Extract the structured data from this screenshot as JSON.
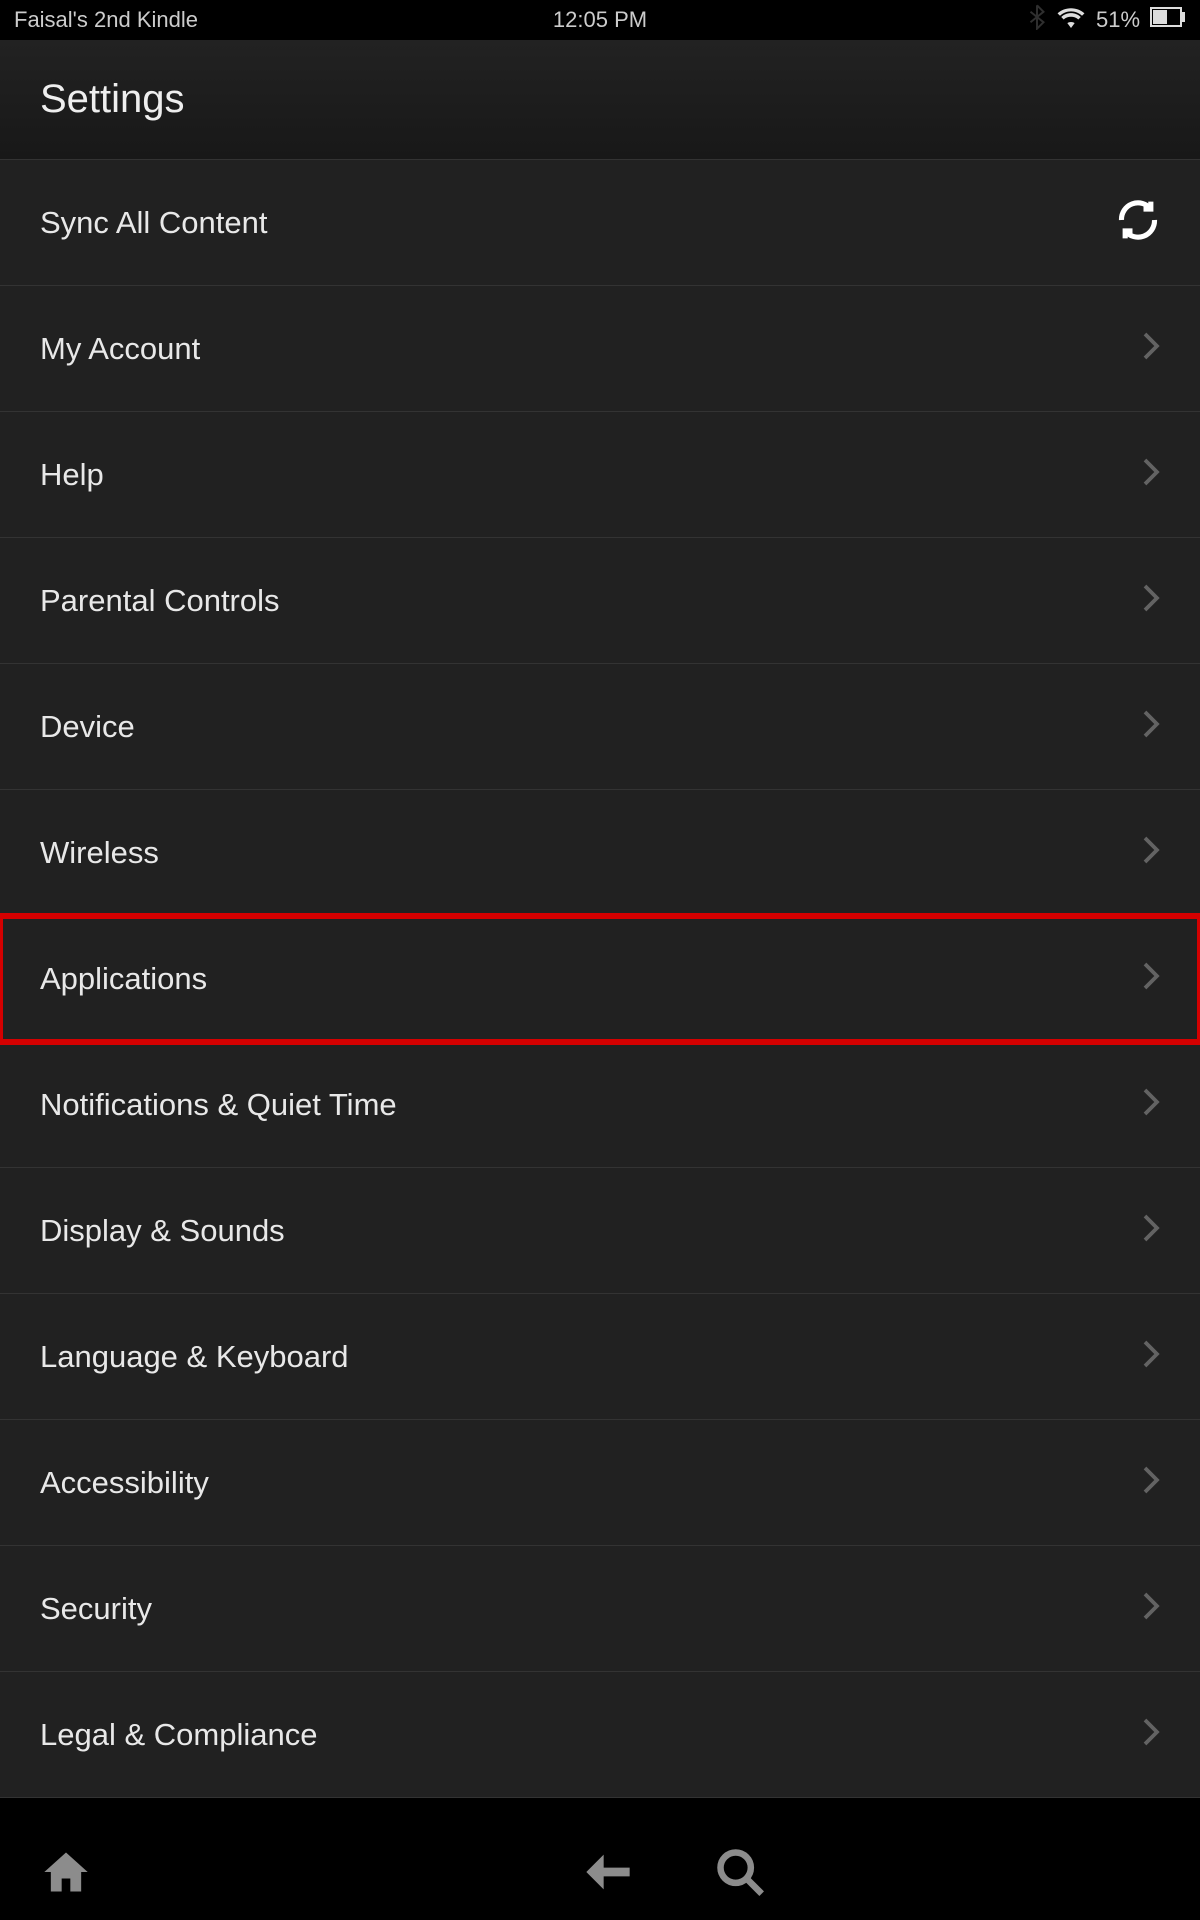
{
  "status_bar": {
    "device_name": "Faisal's 2nd Kindle",
    "time": "12:05 PM",
    "battery_percent": "51%"
  },
  "header": {
    "title": "Settings"
  },
  "items": [
    {
      "label": "Sync All Content",
      "icon": "sync",
      "name": "sync-all-content"
    },
    {
      "label": "My Account",
      "icon": "chevron",
      "name": "my-account"
    },
    {
      "label": "Help",
      "icon": "chevron",
      "name": "help"
    },
    {
      "label": "Parental Controls",
      "icon": "chevron",
      "name": "parental-controls"
    },
    {
      "label": "Device",
      "icon": "chevron",
      "name": "device"
    },
    {
      "label": "Wireless",
      "icon": "chevron",
      "name": "wireless"
    },
    {
      "label": "Applications",
      "icon": "chevron",
      "name": "applications",
      "highlighted": true
    },
    {
      "label": "Notifications & Quiet Time",
      "icon": "chevron",
      "name": "notifications-quiet-time"
    },
    {
      "label": "Display & Sounds",
      "icon": "chevron",
      "name": "display-sounds"
    },
    {
      "label": "Language & Keyboard",
      "icon": "chevron",
      "name": "language-keyboard"
    },
    {
      "label": "Accessibility",
      "icon": "chevron",
      "name": "accessibility"
    },
    {
      "label": "Security",
      "icon": "chevron",
      "name": "security"
    },
    {
      "label": "Legal & Compliance",
      "icon": "chevron",
      "name": "legal-compliance"
    }
  ]
}
